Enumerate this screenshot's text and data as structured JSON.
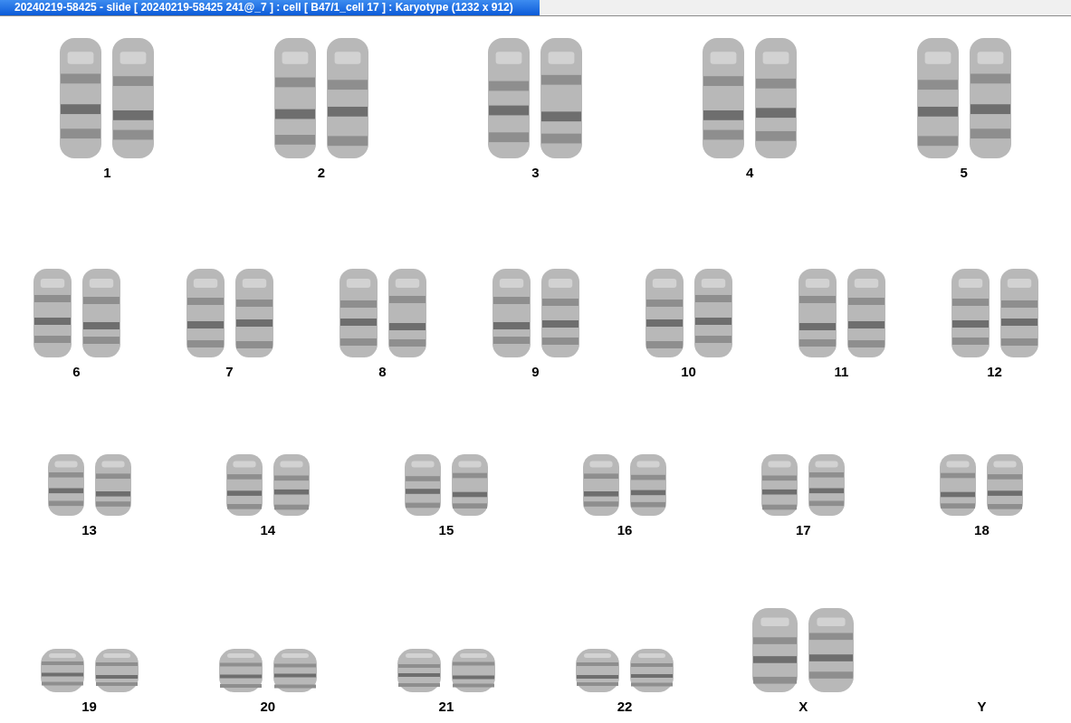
{
  "window": {
    "title": "20240219-58425 - slide [ 20240219-58425 241@_7 ] : cell [ B47/1_cell 17 ] : Karyotype  (1232 x 912)"
  },
  "karyotype": {
    "rows": [
      {
        "pairs": [
          {
            "label": "1",
            "kind": "pair"
          },
          {
            "label": "2",
            "kind": "pair"
          },
          {
            "label": "3",
            "kind": "pair"
          },
          {
            "label": "4",
            "kind": "pair"
          },
          {
            "label": "5",
            "kind": "pair"
          }
        ]
      },
      {
        "pairs": [
          {
            "label": "6",
            "kind": "pair"
          },
          {
            "label": "7",
            "kind": "pair"
          },
          {
            "label": "8",
            "kind": "pair"
          },
          {
            "label": "9",
            "kind": "pair"
          },
          {
            "label": "10",
            "kind": "pair"
          },
          {
            "label": "11",
            "kind": "pair"
          },
          {
            "label": "12",
            "kind": "pair"
          }
        ]
      },
      {
        "pairs": [
          {
            "label": "13",
            "kind": "pair"
          },
          {
            "label": "14",
            "kind": "pair"
          },
          {
            "label": "15",
            "kind": "pair"
          },
          {
            "label": "16",
            "kind": "pair"
          },
          {
            "label": "17",
            "kind": "pair"
          },
          {
            "label": "18",
            "kind": "pair"
          }
        ]
      },
      {
        "pairs": [
          {
            "label": "19",
            "kind": "pair"
          },
          {
            "label": "20",
            "kind": "pair"
          },
          {
            "label": "21",
            "kind": "pair"
          },
          {
            "label": "22",
            "kind": "pair"
          },
          {
            "label": "X",
            "kind": "tall-pair"
          },
          {
            "label": "Y",
            "kind": "empty"
          }
        ]
      }
    ]
  }
}
